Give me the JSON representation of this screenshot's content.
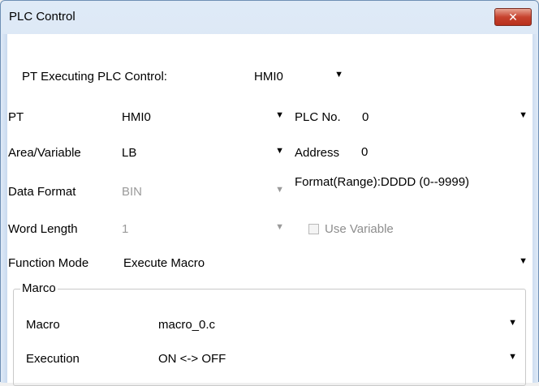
{
  "window": {
    "title": "PLC Control",
    "close_glyph": "✕"
  },
  "form": {
    "pt_exec_label": "PT Executing PLC Control:",
    "pt_exec_value": "HMI0",
    "pt_label": "PT",
    "pt_value": "HMI0",
    "plc_no_label": "PLC No.",
    "plc_no_value": "0",
    "area_label": "Area/Variable",
    "area_value": "LB",
    "address_label": "Address",
    "address_value": "0",
    "data_format_label": "Data Format",
    "data_format_value": "BIN",
    "format_range": "Format(Range):DDDD (0--9999)",
    "word_length_label": "Word Length",
    "word_length_value": "1",
    "use_variable_label": "Use Variable",
    "use_variable_checked": false,
    "function_mode_label": "Function Mode",
    "function_mode_value": "Execute Macro"
  },
  "macro_group": {
    "title": "Marco",
    "macro_label": "Macro",
    "macro_value": "macro_0.c",
    "execution_label": "Execution",
    "execution_value": "ON <-> OFF"
  },
  "icons": {
    "dropdown": "chevron-down-icon",
    "close": "close-icon"
  },
  "colors": {
    "close_button": "#c7432f",
    "titlebar": "#dfeaf7",
    "disabled_text": "#9a9a9a"
  }
}
